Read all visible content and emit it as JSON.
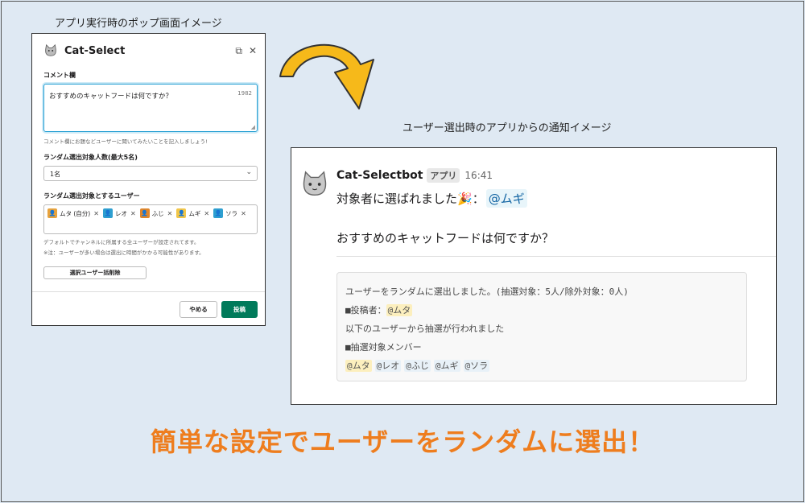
{
  "captions": {
    "popup": "アプリ実行時のポップ画面イメージ",
    "notification": "ユーザー選出時のアプリからの通知イメージ"
  },
  "modal": {
    "title": "Cat-Select",
    "comment_label": "コメント欄",
    "comment_value": "おすすめのキャットフードは何ですか？",
    "comment_counter": "1982",
    "comment_hint": "コメント欄にお題などユーザーに聞いてみたいことを記入しましょう!",
    "count_label": "ランダム選出対象人数(最大5名)",
    "count_value": "1名",
    "users_label": "ランダム選出対象とするユーザー",
    "users": [
      {
        "name": "ムタ (自分)",
        "color": "#e8a33d"
      },
      {
        "name": "レオ",
        "color": "#2e9fd0"
      },
      {
        "name": "ふじ",
        "color": "#e0862b"
      },
      {
        "name": "ムギ",
        "color": "#f2c648"
      },
      {
        "name": "ソラ",
        "color": "#2e9fd0"
      }
    ],
    "users_hint1": "デフォルトでチャンネルに所属する全ユーザーが設定されてます。",
    "users_hint2": "※注：ユーザーが多い場合は選出に時間がかかる可能性があります。",
    "clear_button": "選択ユーザー括削除",
    "cancel_button": "やめる",
    "post_button": "投稿",
    "post_color": "#007a5a"
  },
  "notification": {
    "bot_name": "Cat-Selectbot",
    "badge": "アプリ",
    "time": "16:41",
    "line1": "対象者に選ばれました",
    "party_emoji": "🎉",
    "colon": "：",
    "mention": "@ムギ",
    "question": "おすすめのキャットフードは何ですか？",
    "attach_line1": "ユーザーをランダムに選出しました。(抽選対象：5人/除外対象：0人)",
    "poster_label": "■投稿者：",
    "poster": "@ムタ",
    "attach_line3": "以下のユーザーから抽選が行われました",
    "members_label": "■抽選対象メンバー",
    "members": [
      "@ムタ",
      "@レオ",
      "@ふじ",
      "@ムギ",
      "@ソラ"
    ]
  },
  "tagline": "簡単な設定でユーザーをランダムに選出！",
  "colors": {
    "arrow": "#f6b91a",
    "tagline": "#ee7d1e",
    "background": "#dfe9f3"
  }
}
